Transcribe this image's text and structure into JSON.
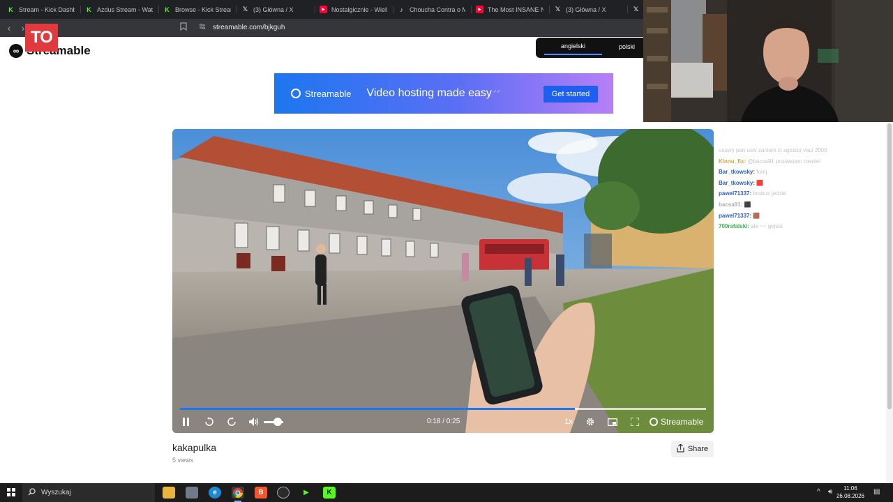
{
  "browser": {
    "tabs": [
      {
        "label": "Stream - Kick Dashboard",
        "icon": "kick-icon",
        "fav": "K",
        "type": "kick"
      },
      {
        "label": "Azdus Stream - Watch",
        "icon": "kick-icon",
        "fav": "K",
        "type": "kick"
      },
      {
        "label": "Browse - Kick Streams",
        "icon": "kick-icon",
        "fav": "K",
        "type": "kick"
      },
      {
        "label": "(3) Główna / X",
        "icon": "x-icon",
        "fav": "𝕏",
        "type": "x"
      },
      {
        "label": "Nostalgicznie - Wielki",
        "icon": "youtube-icon",
        "fav": "▶",
        "type": "yt"
      },
      {
        "label": "Choucha Contra o M",
        "icon": "tiktok-icon",
        "fav": "♪",
        "type": "tt"
      },
      {
        "label": "The Most INSANE NF",
        "icon": "youtube-icon",
        "fav": "▶",
        "type": "yt"
      },
      {
        "label": "(3) Główna / X",
        "icon": "x-icon",
        "fav": "𝕏",
        "type": "x"
      },
      {
        "label": "",
        "icon": "x-icon",
        "fav": "𝕏",
        "type": "x"
      }
    ],
    "url": "streamable.com/bjkguh",
    "overlay_logo": "TO"
  },
  "page": {
    "brand": "Streamable",
    "language": {
      "active": "angielski",
      "other": "polski"
    },
    "banner": {
      "brand": "Streamable",
      "tagline": "Video hosting made easy",
      "cta": "Get started"
    },
    "video": {
      "time": "0:18 / 0:25",
      "progress": 0.75,
      "volume": 0.7,
      "speed": "1x",
      "brand": "Streamable"
    },
    "title": "kakapulka",
    "views": "5 views",
    "share": "Share"
  },
  "chat": [
    {
      "user": "",
      "user_color": "#c9c9c9",
      "msg": "usuwy pan usiv zaniam ci sgozou vaui 2000"
    },
    {
      "user": "Kinnu_fix:",
      "user_color": "#d2a54d",
      "msg": "@bacsa91 poslawiam ciwole!"
    },
    {
      "user": "Bar_tkowsky:",
      "user_color": "#2a5fb8",
      "msg": "fomj"
    },
    {
      "user": "Bar_tkowsky:",
      "user_color": "#2a5fb8",
      "msg": "🟥"
    },
    {
      "user": "pawel71337:",
      "user_color": "#2a5fb8",
      "msg": "brabus jedzie"
    },
    {
      "user": "bacsa91:",
      "user_color": "#aaaaaa",
      "msg": "⬛"
    },
    {
      "user": "pawel71337:",
      "user_color": "#2a5fb8",
      "msg": "🟫"
    },
    {
      "user": "700rafalski:",
      "user_color": "#38b34a",
      "msg": "ale ~~ gejusi"
    }
  ],
  "taskbar": {
    "search_placeholder": "Wyszukaj",
    "time": "11:06",
    "date": "26.08.2026"
  },
  "colors": {
    "accent": "#1d74f5",
    "brand_red": "#e03a3e",
    "kick_green": "#53fc18"
  }
}
